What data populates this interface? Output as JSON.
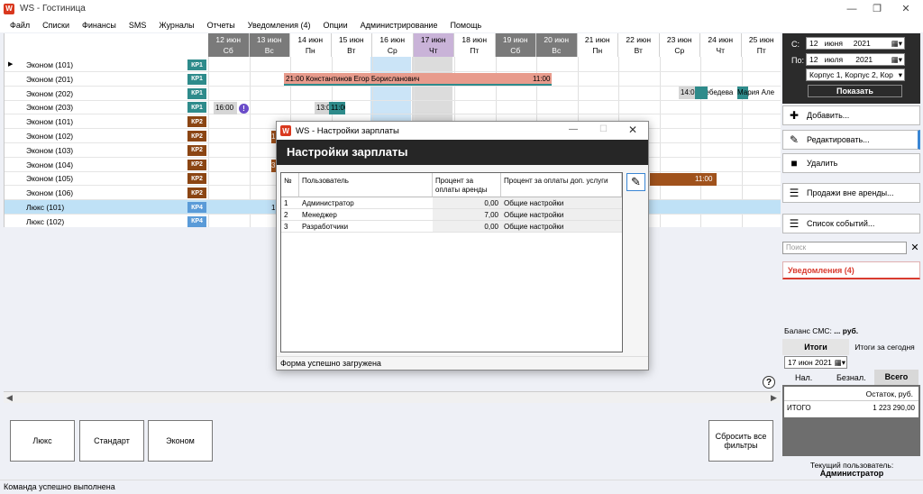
{
  "window": {
    "title": "WS - Гостиница",
    "app_icon": "W"
  },
  "menu": [
    "Файл",
    "Списки",
    "Финансы",
    "SMS",
    "Журналы",
    "Отчеты",
    "Уведомления (4)",
    "Опции",
    "Администрирование",
    "Помощь"
  ],
  "dates": [
    {
      "date": "12 июн",
      "day": "Сб",
      "style": "weekend"
    },
    {
      "date": "13 июн",
      "day": "Вс",
      "style": "weekend"
    },
    {
      "date": "14 июн",
      "day": "Пн",
      "style": "normal"
    },
    {
      "date": "15 июн",
      "day": "Вт",
      "style": "normal"
    },
    {
      "date": "16 июн",
      "day": "Ср",
      "style": "normal"
    },
    {
      "date": "17 июн",
      "day": "Чт",
      "style": "today"
    },
    {
      "date": "18 июн",
      "day": "Пт",
      "style": "normal"
    },
    {
      "date": "19 июн",
      "day": "Сб",
      "style": "weekend"
    },
    {
      "date": "20 июн",
      "day": "Вс",
      "style": "weekend"
    },
    {
      "date": "21 июн",
      "day": "Пн",
      "style": "normal"
    },
    {
      "date": "22 июн",
      "day": "Вт",
      "style": "normal"
    },
    {
      "date": "23 июн",
      "day": "Ср",
      "style": "normal"
    },
    {
      "date": "24 июн",
      "day": "Чт",
      "style": "normal"
    },
    {
      "date": "25 июн",
      "day": "Пт",
      "style": "normal"
    }
  ],
  "rooms": [
    {
      "name": "Эконом (101)",
      "badge": "КР1",
      "kind": "kp1",
      "current": true
    },
    {
      "name": "Эконом (201)",
      "badge": "КР1",
      "kind": "kp1"
    },
    {
      "name": "Эконом (202)",
      "badge": "КР1",
      "kind": "kp1"
    },
    {
      "name": "Эконом (203)",
      "badge": "КР1",
      "kind": "kp1"
    },
    {
      "name": "Эконом (101)",
      "badge": "КР2",
      "kind": "kp2"
    },
    {
      "name": "Эконом (102)",
      "badge": "КР2",
      "kind": "kp2"
    },
    {
      "name": "Эконом (103)",
      "badge": "КР2",
      "kind": "kp2"
    },
    {
      "name": "Эконом (104)",
      "badge": "КР2",
      "kind": "kp2"
    },
    {
      "name": "Эконом (105)",
      "badge": "КР2",
      "kind": "kp2"
    },
    {
      "name": "Эконом (106)",
      "badge": "КР2",
      "kind": "kp2"
    },
    {
      "name": "Люкс (101)",
      "badge": "КР4",
      "kind": "kp4",
      "selected": true
    },
    {
      "name": "Люкс (102)",
      "badge": "КР4",
      "kind": "kp4"
    }
  ],
  "bookings": {
    "b201_start": "21:00 Константинов Егор Борисланович",
    "b201_end": "11:00",
    "b202_start": "14:00 Лебедева",
    "b202_guest2": "Мария Але",
    "b203_start": "16:00",
    "b203_mid": "13:0",
    "b203_end": "11:00",
    "b105_end": "11:00",
    "l101_mark": "1",
    "k102_mark": "1",
    "k104_mark": "3"
  },
  "bottom_buttons": [
    "Люкс",
    "Стандарт",
    "Эконом",
    "Сбросить все фильтры"
  ],
  "filters": {
    "from_label": "С:",
    "from_day": "12",
    "from_month": "июня",
    "from_year": "2021",
    "to_label": "По:",
    "to_day": "12",
    "to_month": "июля",
    "to_year": "2021",
    "building": "Корпус 1, Корпус 2, Кор",
    "show_button": "Показать"
  },
  "actions": {
    "add": "Добавить...",
    "edit": "Редактировать...",
    "delete": "Удалить",
    "sales": "Продажи вне аренды...",
    "events": "Список событий..."
  },
  "search": {
    "placeholder": "Поиск"
  },
  "notifications": "Уведомления (4)",
  "sms_balance_label": "Баланс СМС:",
  "sms_balance_value": "... руб.",
  "totals": {
    "tab_totals": "Итоги",
    "today_label": "Итоги за сегодня",
    "date": "17 июн 2021",
    "cash": "Нал.",
    "noncash": "Безнал.",
    "all": "Всего",
    "remainder_header": "Остаток, руб.",
    "total_label": "ИТОГО",
    "total_value": "1 223 290,00"
  },
  "current_user_label": "Текущий пользователь:",
  "current_user": "Администратор",
  "status_text": "Команда успешно выполнена",
  "dialog": {
    "title": "WS - Настройки зарплаты",
    "header": "Настройки зарплаты",
    "columns": [
      "№",
      "Пользователь",
      "Процент за оплаты аренды",
      "Процент за оплаты доп. услуги"
    ],
    "rows": [
      {
        "n": "1",
        "user": "Администратор",
        "rent": "0,00",
        "extra": "Общие настройки"
      },
      {
        "n": "2",
        "user": "Менеджер",
        "rent": "7,00",
        "extra": "Общие настройки"
      },
      {
        "n": "3",
        "user": "Разработчики",
        "rent": "0,00",
        "extra": "Общие настройки"
      }
    ],
    "status": "Форма успешно загружена"
  }
}
